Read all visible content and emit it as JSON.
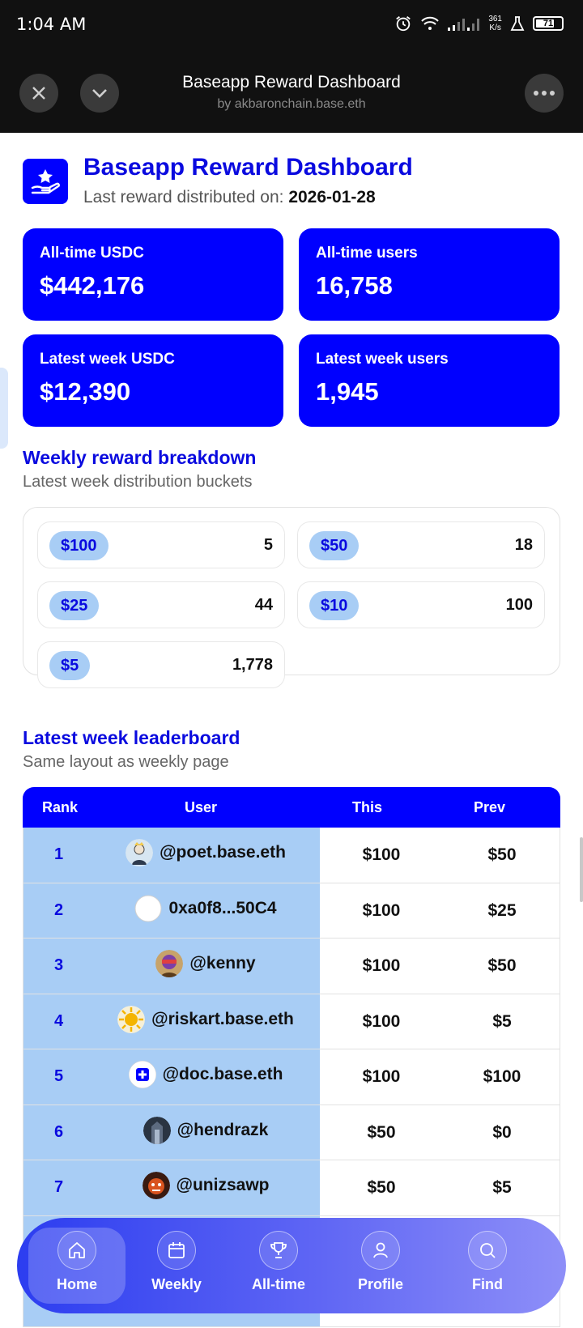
{
  "status_bar": {
    "time": "1:04 AM",
    "net_speed_top": "361",
    "net_speed_bottom": "K/s",
    "battery": "71"
  },
  "header": {
    "title": "Baseapp Reward Dashboard",
    "subtitle": "by akbaronchain.base.eth"
  },
  "page": {
    "title": "Baseapp Reward Dashboard",
    "last_reward_label": "Last reward distributed on: ",
    "last_reward_date": "2026-01-28"
  },
  "stats": [
    {
      "label": "All-time USDC",
      "value": "$442,176"
    },
    {
      "label": "All-time users",
      "value": "16,758"
    },
    {
      "label": "Latest week USDC",
      "value": "$12,390"
    },
    {
      "label": "Latest week users",
      "value": "1,945"
    }
  ],
  "breakdown": {
    "title": "Weekly reward breakdown",
    "subtitle": "Latest week distribution buckets",
    "buckets": [
      {
        "amount": "$100",
        "count": "5"
      },
      {
        "amount": "$50",
        "count": "18"
      },
      {
        "amount": "$25",
        "count": "44"
      },
      {
        "amount": "$10",
        "count": "100"
      },
      {
        "amount": "$5",
        "count": "1,778"
      }
    ]
  },
  "leaderboard": {
    "title": "Latest week leaderboard",
    "subtitle": "Same layout as weekly page",
    "columns": {
      "rank": "Rank",
      "user": "User",
      "this": "This",
      "prev": "Prev"
    },
    "rows": [
      {
        "rank": "1",
        "user": "@poet.base.eth",
        "this": "$100",
        "prev": "$50"
      },
      {
        "rank": "2",
        "user": "0xa0f8...50C4",
        "this": "$100",
        "prev": "$25"
      },
      {
        "rank": "3",
        "user": "@kenny",
        "this": "$100",
        "prev": "$50"
      },
      {
        "rank": "4",
        "user": "@riskart.base.eth",
        "this": "$100",
        "prev": "$5"
      },
      {
        "rank": "5",
        "user": "@doc.base.eth",
        "this": "$100",
        "prev": "$100"
      },
      {
        "rank": "6",
        "user": "@hendrazk",
        "this": "$50",
        "prev": "$0"
      },
      {
        "rank": "7",
        "user": "@unizsawp",
        "this": "$50",
        "prev": "$5"
      }
    ]
  },
  "nav": [
    {
      "label": "Home",
      "icon": "home-icon",
      "active": true
    },
    {
      "label": "Weekly",
      "icon": "calendar-icon",
      "active": false
    },
    {
      "label": "All-time",
      "icon": "trophy-icon",
      "active": false
    },
    {
      "label": "Profile",
      "icon": "user-icon",
      "active": false
    },
    {
      "label": "Find",
      "icon": "search-icon",
      "active": false
    }
  ],
  "colors": {
    "brand_blue": "#0000ff",
    "title_blue": "#0a0adf",
    "light_blue": "#a8cdf5"
  }
}
